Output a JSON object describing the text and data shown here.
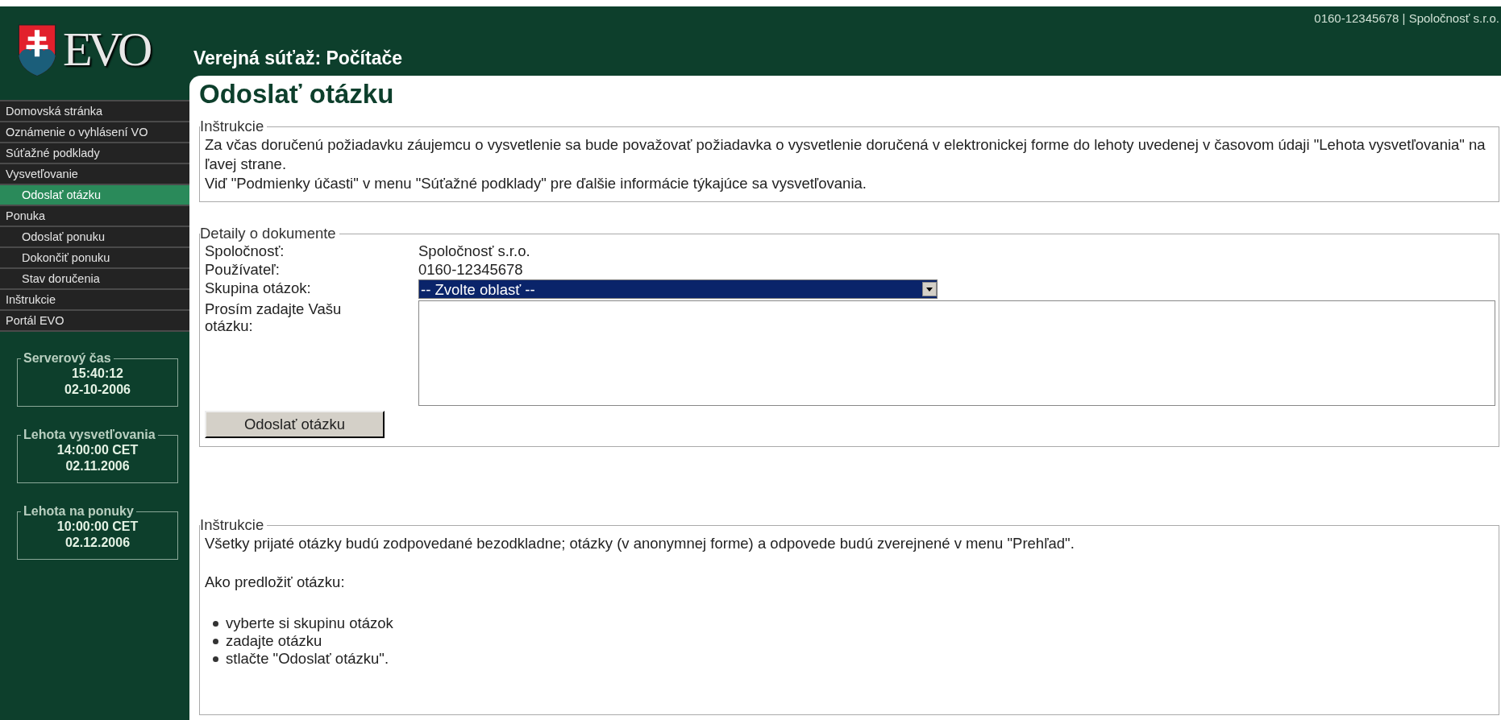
{
  "header": {
    "account": "0160-12345678 | Spoločnosť s.r.o.",
    "logo_text": "EVO",
    "title": "Verejná súťaž: Počítače"
  },
  "sidebar": {
    "items": [
      {
        "label": "Domovská stránka",
        "selected": false
      },
      {
        "label": "Oznámenie o vyhlásení VO",
        "selected": false
      },
      {
        "label": "Súťažné podklady",
        "selected": false
      },
      {
        "label": "Vysvetľovanie",
        "selected": false,
        "children": [
          {
            "label": "Odoslať otázku",
            "selected": true
          }
        ]
      },
      {
        "label": "Ponuka",
        "selected": false,
        "children": [
          {
            "label": "Odoslať ponuku",
            "selected": false
          },
          {
            "label": "Dokončiť ponuku",
            "selected": false
          },
          {
            "label": "Stav doručenia",
            "selected": false
          }
        ]
      },
      {
        "label": "Inštrukcie",
        "selected": false
      },
      {
        "label": "Portál EVO",
        "selected": false
      }
    ],
    "panels": [
      {
        "title": "Serverový čas",
        "lines": [
          "15:40:12",
          "02-10-2006"
        ]
      },
      {
        "title": "Lehota vysvetľovania",
        "lines": [
          "14:00:00 CET",
          "02.11.2006"
        ]
      },
      {
        "title": "Lehota na ponuky",
        "lines": [
          "10:00:00 CET",
          "02.12.2006"
        ]
      }
    ]
  },
  "main": {
    "heading": "Odoslať otázku",
    "instructions": {
      "legend": "Inštrukcie",
      "paragraphs": [
        "Za včas doručenú požiadavku záujemcu o vysvetlenie sa bude považovať požiadavka o vysvetlenie doručená v elektronickej forme do lehoty uvedenej v časovom údaji \"Lehota vysvetľovania\" na ľavej strane.",
        "Viď \"Podmienky účasti\" v menu \"Súťažné podklady\" pre ďalšie informácie týkajúce sa vysvetľovania."
      ]
    },
    "details": {
      "legend": "Detaily o dokumente",
      "fields": [
        {
          "kind": "text",
          "label": "Spoločnosť:",
          "value": "Spoločnosť s.r.o."
        },
        {
          "kind": "text",
          "label": "Používateľ:",
          "value": "0160-12345678"
        },
        {
          "kind": "select",
          "label": "Skupina otázok:",
          "value": "-- Zvolte oblasť --"
        },
        {
          "kind": "textarea",
          "label": "Prosím zadajte Vašu otázku:"
        }
      ],
      "button": "Odoslať otázku"
    },
    "help": {
      "legend": "Inštrukcie",
      "paragraphs": [
        "Všetky prijaté otázky budú zodpovedané bezodkladne; otázky (v anonymnej forme) a odpovede budú zverejnené v menu \"Prehľad\".",
        "Ako predložiť otázku:"
      ],
      "steps": [
        "vyberte si skupinu otázok",
        "zadajte otázku",
        "stlačte \"Odoslať otázku\"."
      ]
    }
  }
}
